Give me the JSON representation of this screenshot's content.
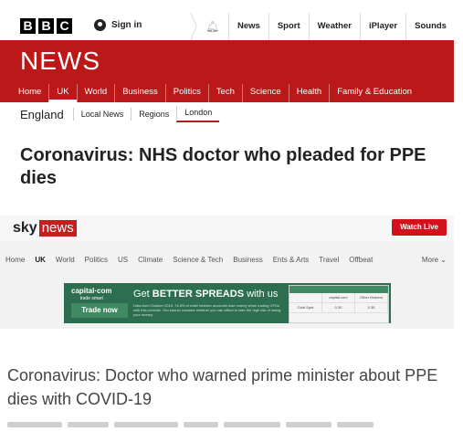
{
  "bbc": {
    "logo_letters": [
      "B",
      "B",
      "C"
    ],
    "sign_in": "Sign in",
    "nav": [
      "News",
      "Sport",
      "Weather",
      "iPlayer",
      "Sounds"
    ],
    "news_wordmark": "NEWS",
    "news_nav": [
      "Home",
      "UK",
      "World",
      "Business",
      "Politics",
      "Tech",
      "Science",
      "Health",
      "Family & Education"
    ],
    "news_nav_active": "UK",
    "region": "England",
    "sub_nav": [
      "Local News",
      "Regions",
      "London"
    ],
    "sub_nav_active": "London",
    "headline": "Coronavirus: NHS doctor who pleaded for PPE dies",
    "colors": {
      "brand_red": "#bb1919"
    }
  },
  "sky": {
    "logo_sky": "sky",
    "logo_news": "news",
    "watch_live": "Watch Live",
    "nav": [
      "Home",
      "UK",
      "World",
      "Politics",
      "US",
      "Climate",
      "Science & Tech",
      "Business",
      "Ents & Arts",
      "Travel",
      "Offbeat"
    ],
    "nav_active": "UK",
    "more": "More",
    "ad": {
      "brand": "capital·com",
      "brand_tag": "trade smart",
      "button": "Trade now",
      "headline_prefix": "Get ",
      "headline_bold": "BETTER SPREADS",
      "headline_suffix": " with us",
      "small_print": "Data from October 2019. 74.8% of retail investor accounts lose money when trading CFDs with this provider. You should consider whether you can afford to take the high risk of losing your money.",
      "table_head": [
        "",
        "capital.com",
        "Other Brokers"
      ],
      "table_row": [
        "Gold Spot",
        "0.30",
        "0.35"
      ]
    },
    "headline": "Coronavirus: Doctor who warned prime minister about PPE dies with COVID-19",
    "colors": {
      "brand_red": "#c41f1f",
      "ad_green": "#2c6e4f"
    }
  }
}
